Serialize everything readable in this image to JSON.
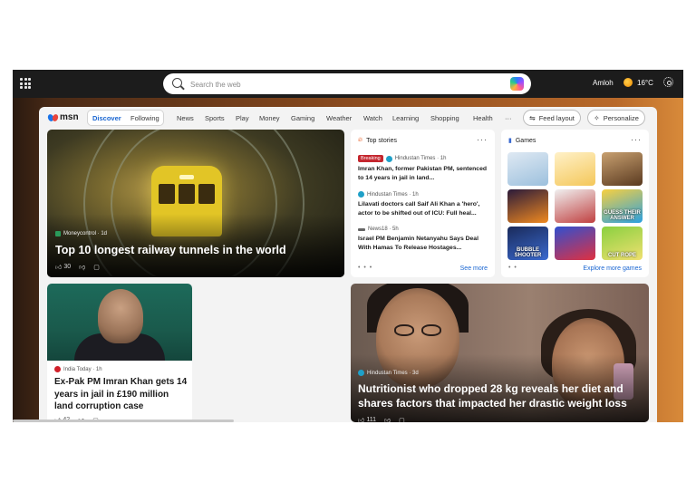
{
  "search": {
    "placeholder": "Search the web"
  },
  "header": {
    "user": "Amloh",
    "temperature": "16°C",
    "weather_icon": "sun-icon"
  },
  "brand": {
    "logo_text": "msn"
  },
  "nav": {
    "tabs": [
      "Discover",
      "Following"
    ],
    "items": [
      "News",
      "Sports",
      "Play",
      "Money",
      "Gaming",
      "Weather",
      "Watch",
      "Learning",
      "Shopping",
      "Health"
    ],
    "more": "···",
    "feed_layout": "Feed layout",
    "personalize": "Personalize"
  },
  "hero": {
    "source": "Moneycontrol · 1d",
    "title": "Top 10 longest railway tunnels in the world",
    "likes": "30"
  },
  "top_stories": {
    "heading": "Top stories",
    "more": "···",
    "stories": [
      {
        "badge": "Breaking",
        "source": "Hindustan Times · 1h",
        "headline": "Imran Khan, former Pakistan PM, sentenced to 14 years in jail in land..."
      },
      {
        "source": "Hindustan Times · 1h",
        "headline": "Lilavati doctors call Saif Ali Khan a 'hero', actor to be shifted out of ICU: Full heal..."
      },
      {
        "source": "News18 · 5h",
        "headline": "Israel PM Benjamin Netanyahu Says Deal With Hamas To Release Hostages..."
      }
    ],
    "pager": "• • •",
    "see_more": "See more"
  },
  "games": {
    "heading": "Games",
    "more": "···",
    "tiles": [
      {
        "label": "",
        "color_a": "#dfe9f3",
        "color_b": "#9cc0dd"
      },
      {
        "label": "",
        "color_a": "#fff1c8",
        "color_b": "#f4c75a"
      },
      {
        "label": "",
        "color_a": "#c8a070",
        "color_b": "#5a3a20"
      },
      {
        "label": "",
        "color_a": "#2a1a3a",
        "color_b": "#f08a20"
      },
      {
        "label": "",
        "color_a": "#f0f0f0",
        "color_b": "#c04040"
      },
      {
        "label": "GUESS THEIR ANSWER",
        "color_a": "#f8d040",
        "color_b": "#2aa0e0"
      },
      {
        "label": "BUBBLE SHOOTER",
        "color_a": "#1a2a5a",
        "color_b": "#3a6ad0"
      },
      {
        "label": "",
        "color_a": "#3050d0",
        "color_b": "#e03040"
      },
      {
        "label": "CUT ROPE",
        "color_a": "#8ad040",
        "color_b": "#f0e070"
      }
    ],
    "pager": "• •",
    "explore": "Explore more games"
  },
  "imran_card": {
    "source": "India Today · 1h",
    "title": "Ex-Pak PM Imran Khan gets 14 years in jail in £190 million land corruption case",
    "likes": "42"
  },
  "nutri_card": {
    "source": "Hindustan Times · 3d",
    "title": "Nutritionist who dropped 28 kg reveals her diet and shares factors that impacted her drastic weight loss",
    "likes": "111"
  }
}
